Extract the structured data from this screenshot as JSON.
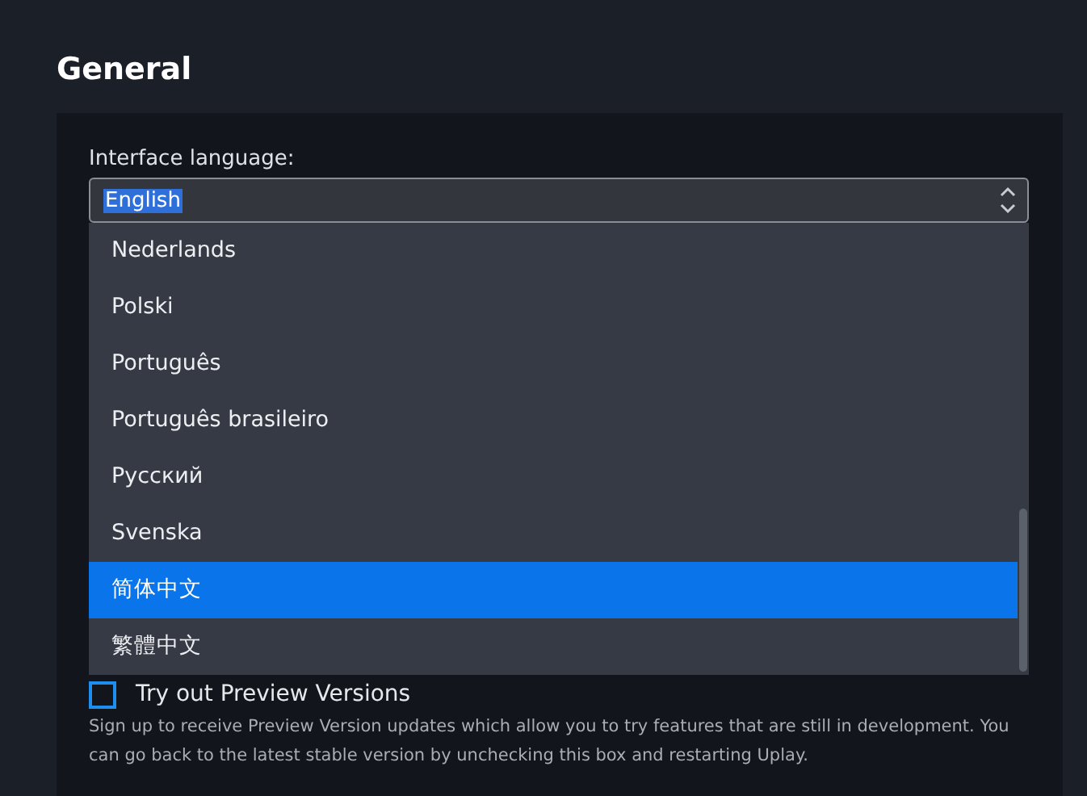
{
  "title": "General",
  "language": {
    "label": "Interface language:",
    "value": "English",
    "value_highlighted": true,
    "options": [
      {
        "label": "Nederlands",
        "selected": false
      },
      {
        "label": "Polski",
        "selected": false
      },
      {
        "label": "Português",
        "selected": false
      },
      {
        "label": "Português brasileiro",
        "selected": false
      },
      {
        "label": "Русский",
        "selected": false
      },
      {
        "label": "Svenska",
        "selected": false
      },
      {
        "label": "简体中文",
        "selected": true
      },
      {
        "label": "繁體中文",
        "selected": false
      }
    ]
  },
  "preview": {
    "label": "Try out Preview Versions",
    "checked": false,
    "description": "Sign up to receive Preview Version updates which allow you to try features that are still in development. You can go back to the latest stable version by unchecking this box and restarting Uplay."
  }
}
